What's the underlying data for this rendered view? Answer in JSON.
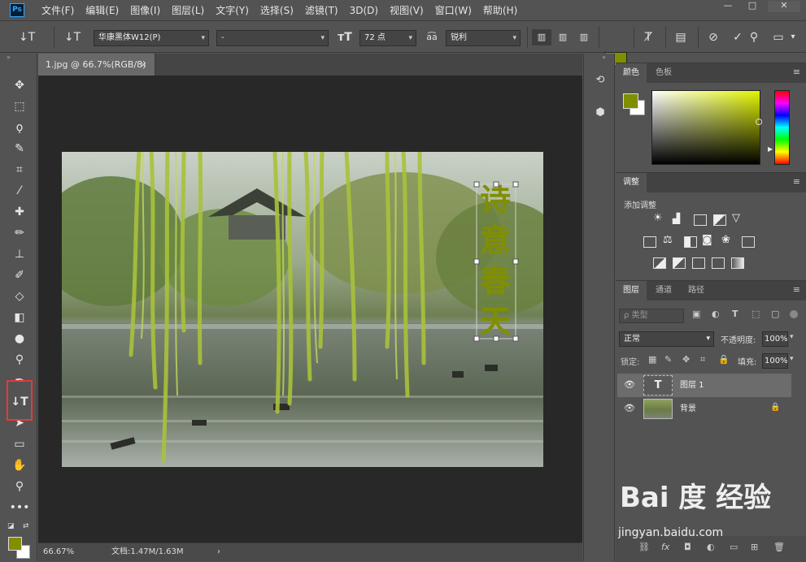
{
  "app": {
    "logo": "Ps"
  },
  "menu": [
    "文件(F)",
    "编辑(E)",
    "图像(I)",
    "图层(L)",
    "文字(Y)",
    "选择(S)",
    "滤镜(T)",
    "3D(D)",
    "视图(V)",
    "窗口(W)",
    "帮助(H)"
  ],
  "window_controls": {
    "minimize": "—",
    "maximize": "□",
    "close": "✕"
  },
  "options": {
    "font_family": "华康黑体W12(P)",
    "font_style": "-",
    "font_size": "72 点",
    "antialias": "锐利",
    "text_color": "#808f00",
    "aa_label": "a͡a"
  },
  "document": {
    "tab_title": "1.jpg @ 66.7%(RGB/8)",
    "tab_close": "×",
    "zoom": "66.67%",
    "doc_info": "文档:1.47M/1.63M",
    "status_arrow": "›"
  },
  "photo_text": [
    "诗",
    "意",
    "春",
    "天"
  ],
  "panels": {
    "color": {
      "tabs": [
        "颜色",
        "色板"
      ],
      "fg": "#808f00",
      "bg": "#ffffff"
    },
    "adjust": {
      "tab": "调整",
      "title": "添加调整"
    },
    "layers": {
      "tabs": [
        "图层",
        "通道",
        "路径"
      ],
      "filter_placeholder": "ρ 类型",
      "blend_mode": "正常",
      "opacity_label": "不透明度:",
      "opacity": "100%",
      "lock_label": "锁定:",
      "fill_label": "填充:",
      "fill": "100%",
      "items": [
        {
          "name": "图层 1",
          "type": "text",
          "thumb_glyph": "T"
        },
        {
          "name": "背景",
          "type": "image",
          "lock": "🔒"
        }
      ]
    }
  },
  "watermark": {
    "logo": "Bai 度 经验",
    "url": "jingyan.baidu.com"
  },
  "accent": "#808f00"
}
